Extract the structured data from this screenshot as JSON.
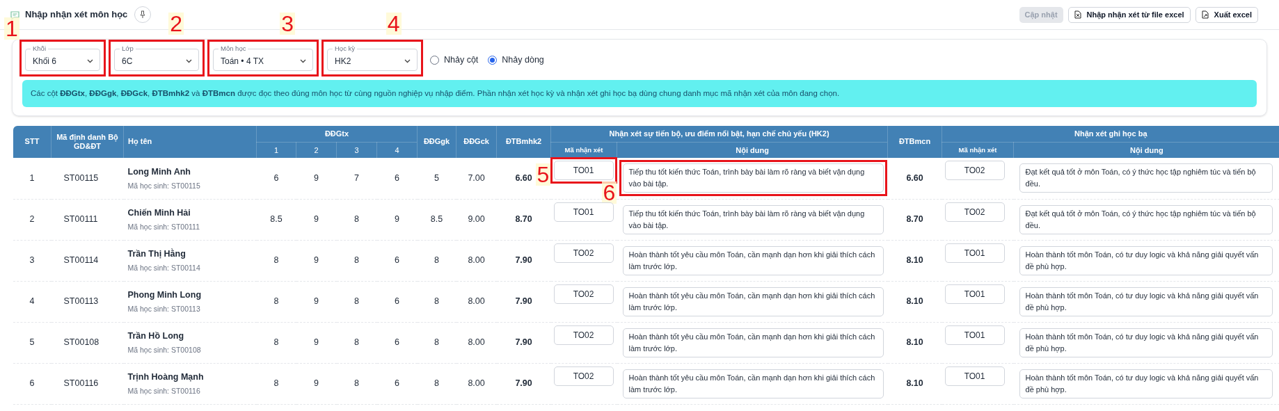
{
  "header": {
    "title": "Nhập nhận xét môn học",
    "buttons": [
      {
        "label": "Cập nhật",
        "kind": "plain",
        "disabled": true
      },
      {
        "label": "Nhập nhận xét từ file excel",
        "kind": "import",
        "disabled": false
      },
      {
        "label": "Xuất excel",
        "kind": "export",
        "disabled": false
      }
    ]
  },
  "filters": [
    {
      "label": "Khối",
      "value": "Khối 6",
      "callout": "1"
    },
    {
      "label": "Lớp",
      "value": "6C",
      "callout": "2"
    },
    {
      "label": "Môn học",
      "value": "Toán • 4 TX",
      "callout": "3"
    },
    {
      "label": "Học kỳ",
      "value": "HK2",
      "callout": "4"
    }
  ],
  "jump_mode": [
    {
      "label": "Nhảy cột",
      "selected": false
    },
    {
      "label": "Nhảy dòng",
      "selected": true
    }
  ],
  "info": "Các cột **ĐĐGtx**, **ĐĐGgk**, **ĐĐGck**, **ĐTBmhk2** và **ĐTBmcn** được đọc theo đúng môn học từ cùng nguồn nghiệp vụ nhập điểm. Phần nhận xét học kỳ và nhận xét ghi học bạ dùng chung danh mục mã nhận xét của môn đang chọn.",
  "table": {
    "columns": [
      {
        "label": "STT"
      },
      {
        "label": "Mã định danh Bộ GD&ĐT"
      },
      {
        "label": "Họ tên"
      },
      {
        "label": "ĐĐGtx",
        "sub": [
          "1",
          "2",
          "3",
          "4"
        ]
      },
      {
        "label": "ĐĐGgk"
      },
      {
        "label": "ĐĐGck"
      },
      {
        "label": "ĐTBmhk2"
      },
      {
        "label": "Nhận xét sự tiến bộ, ưu điểm nổi bật, hạn chế chủ yếu (HK2)",
        "sub": [
          "Mã nhận xét",
          "Nội dung"
        ]
      },
      {
        "label": "ĐTBmcn"
      },
      {
        "label": "Nhận xét ghi học bạ",
        "sub": [
          "Mã nhận xét",
          "Nội dung"
        ]
      }
    ],
    "rows": [
      {
        "stt": "1",
        "id": "ST00115",
        "name": "Long Minh Anh",
        "student_code": "Mã học sinh: ST00115",
        "tx": [
          "6",
          "9",
          "7",
          "6"
        ],
        "gk": "5",
        "ck": "7.00",
        "tb_hk2": "6.60",
        "comment_code": "TO01",
        "comment": "Tiếp thu tốt kiến thức Toán, trình bày bài làm rõ ràng và biết vận dụng vào bài tập.",
        "tb_cn": "6.60",
        "record_code": "TO02",
        "record_comment": "Đạt kết quả tốt ở môn Toán, có ý thức học tập nghiêm túc và tiến bộ đều.",
        "callouts": {
          "comment_code": "5",
          "comment": "6"
        }
      },
      {
        "stt": "2",
        "id": "ST00111",
        "name": "Chiến Minh Hải",
        "student_code": "Mã học sinh: ST00111",
        "tx": [
          "8.5",
          "9",
          "8",
          "9"
        ],
        "gk": "8.5",
        "ck": "9.00",
        "tb_hk2": "8.70",
        "comment_code": "TO01",
        "comment": "Tiếp thu tốt kiến thức Toán, trình bày bài làm rõ ràng và biết vận dụng vào bài tập.",
        "tb_cn": "8.70",
        "record_code": "TO02",
        "record_comment": "Đạt kết quả tốt ở môn Toán, có ý thức học tập nghiêm túc và tiến bộ đều."
      },
      {
        "stt": "3",
        "id": "ST00114",
        "name": "Trần Thị Hằng",
        "student_code": "Mã học sinh: ST00114",
        "tx": [
          "8",
          "9",
          "8",
          "6"
        ],
        "gk": "8",
        "ck": "8.00",
        "tb_hk2": "7.90",
        "comment_code": "TO02",
        "comment": "Hoàn thành tốt yêu cầu môn Toán, cần mạnh dạn hơn khi giải thích cách làm trước lớp.",
        "tb_cn": "8.10",
        "record_code": "TO01",
        "record_comment": "Hoàn thành tốt môn Toán, có tư duy logic và khả năng giải quyết vấn đề phù hợp."
      },
      {
        "stt": "4",
        "id": "ST00113",
        "name": "Phong Minh Long",
        "student_code": "Mã học sinh: ST00113",
        "tx": [
          "8",
          "9",
          "8",
          "6"
        ],
        "gk": "8",
        "ck": "8.00",
        "tb_hk2": "7.90",
        "comment_code": "TO02",
        "comment": "Hoàn thành tốt yêu cầu môn Toán, cần mạnh dạn hơn khi giải thích cách làm trước lớp.",
        "tb_cn": "8.10",
        "record_code": "TO01",
        "record_comment": "Hoàn thành tốt môn Toán, có tư duy logic và khả năng giải quyết vấn đề phù hợp."
      },
      {
        "stt": "5",
        "id": "ST00108",
        "name": "Trần Hồ Long",
        "student_code": "Mã học sinh: ST00108",
        "tx": [
          "8",
          "9",
          "8",
          "6"
        ],
        "gk": "8",
        "ck": "8.00",
        "tb_hk2": "7.90",
        "comment_code": "TO02",
        "comment": "Hoàn thành tốt yêu cầu môn Toán, cần mạnh dạn hơn khi giải thích cách làm trước lớp.",
        "tb_cn": "8.10",
        "record_code": "TO01",
        "record_comment": "Hoàn thành tốt môn Toán, có tư duy logic và khả năng giải quyết vấn đề phù hợp."
      },
      {
        "stt": "6",
        "id": "ST00116",
        "name": "Trịnh Hoàng Mạnh",
        "student_code": "Mã học sinh: ST00116",
        "tx": [
          "8",
          "9",
          "8",
          "6"
        ],
        "gk": "8",
        "ck": "8.00",
        "tb_hk2": "7.90",
        "comment_code": "TO02",
        "comment": "Hoàn thành tốt yêu cầu môn Toán, cần mạnh dạn hơn khi giải thích cách làm trước lớp.",
        "tb_cn": "8.10",
        "record_code": "TO01",
        "record_comment": "Hoàn thành tốt môn Toán, có tư duy logic và khả năng giải quyết vấn đề phù hợp."
      }
    ]
  }
}
